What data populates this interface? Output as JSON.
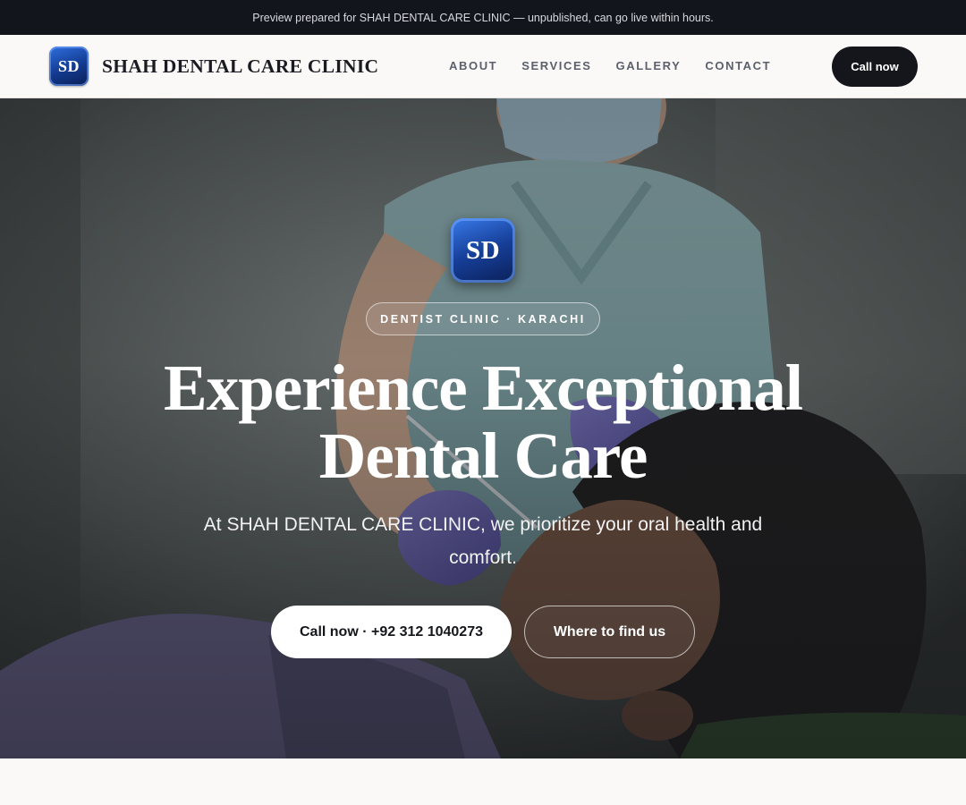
{
  "preview_banner": "Preview prepared for SHAH DENTAL CARE CLINIC — unpublished, can go live within hours.",
  "header": {
    "logo_initials": "SD",
    "brand_name": "SHAH DENTAL CARE CLINIC",
    "nav": [
      "ABOUT",
      "SERVICES",
      "GALLERY",
      "CONTACT"
    ],
    "call_label": "Call now"
  },
  "hero": {
    "logo_initials": "SD",
    "tag": "DENTIST CLINIC · KARACHI",
    "headline_line1": "Experience Exceptional",
    "headline_line2": "Dental Care",
    "subtitle": "At SHAH DENTAL CARE CLINIC, we prioritize your oral health and comfort.",
    "primary_cta": "Call now · +92 312 1040273",
    "secondary_cta": "Where to find us",
    "background_photo": "dentist-examining-patient"
  },
  "colors": {
    "topbar": "#12151c",
    "nav_bg": "#faf9f7",
    "dark_button": "#14161c",
    "logo_blue": "#163f99"
  }
}
